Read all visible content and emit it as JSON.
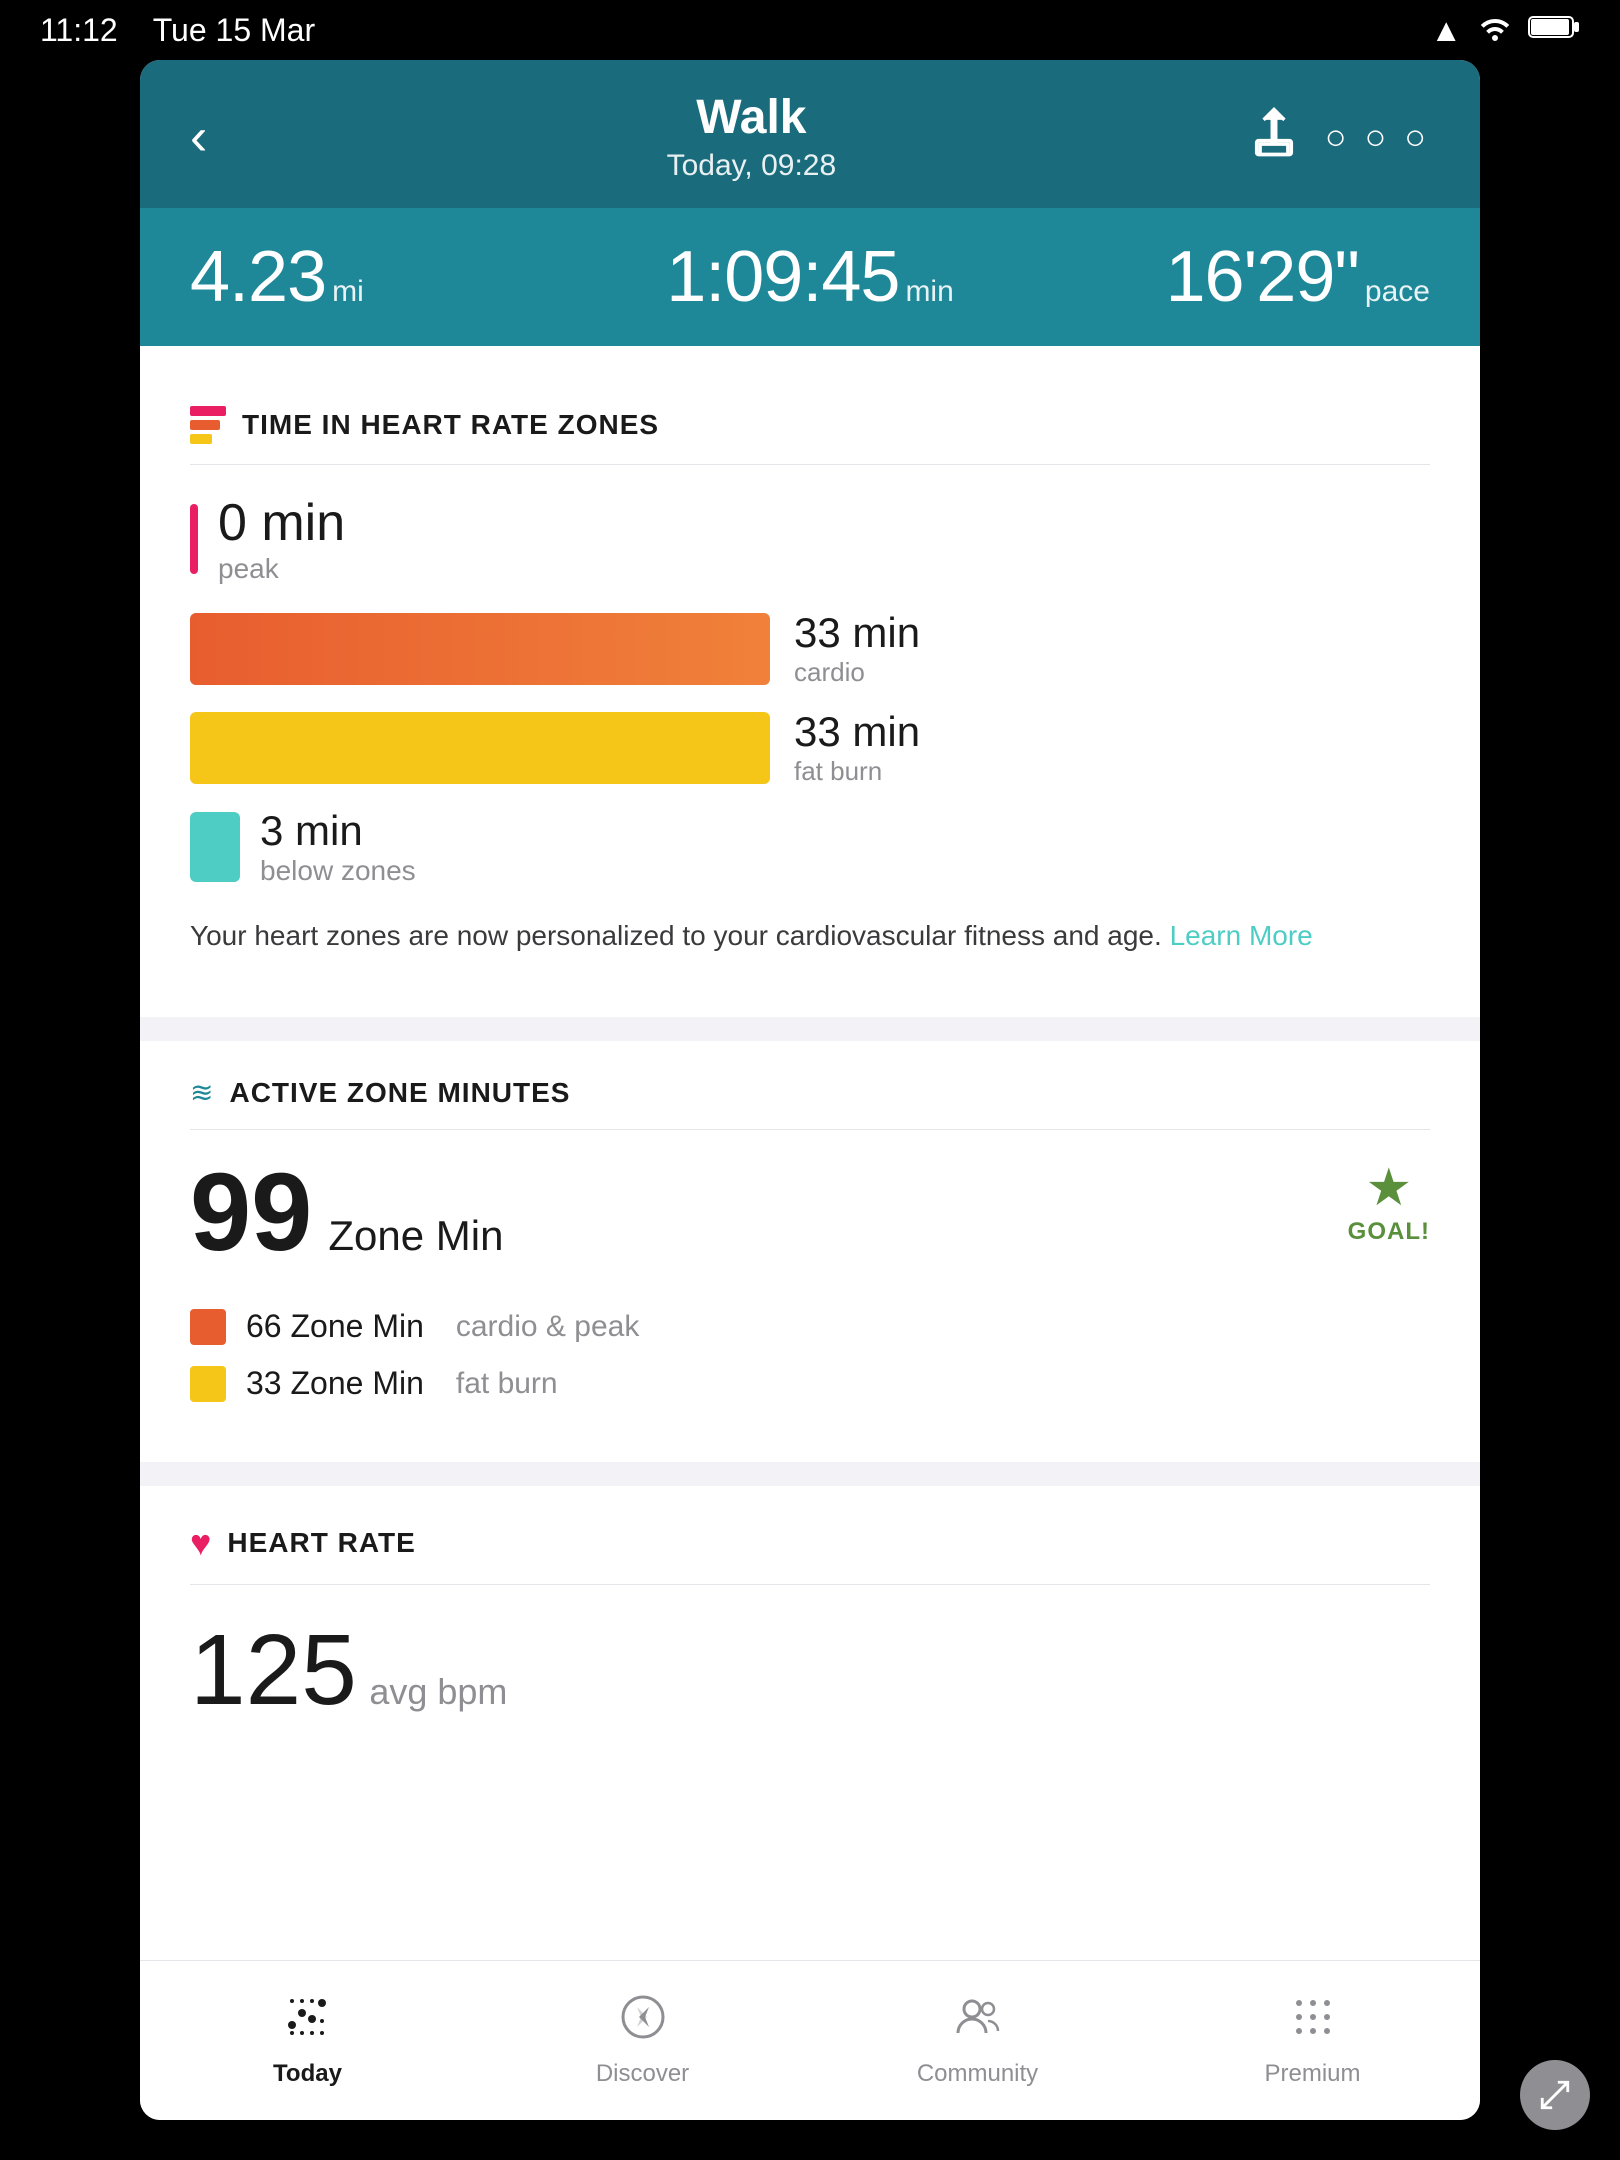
{
  "statusBar": {
    "time": "11:12",
    "date": "Tue 15 Mar",
    "battery": "93%"
  },
  "header": {
    "back": "‹",
    "title": "Walk",
    "subtitle": "Today, 09:28",
    "share": "⬆",
    "dots": "○ ○ ○"
  },
  "stats": {
    "distance": {
      "value": "4.23",
      "unit": "mi"
    },
    "duration": {
      "value": "1:09:45",
      "unit": "min"
    },
    "pace": {
      "value": "16'29\"",
      "unit": "pace"
    }
  },
  "heartRateZones": {
    "sectionTitle": "TIME IN HEART RATE ZONES",
    "peak": {
      "value": "0 min",
      "label": "peak"
    },
    "cardio": {
      "value": "33 min",
      "label": "cardio"
    },
    "fatBurn": {
      "value": "33 min",
      "label": "fat burn"
    },
    "belowZones": {
      "value": "3 min",
      "label": "below zones"
    },
    "infoText": "Your heart zones are now personalized to your cardiovascular fitness and age.",
    "learnMore": "Learn More"
  },
  "activeZoneMinutes": {
    "sectionTitle": "ACTIVE ZONE MINUTES",
    "totalValue": "99",
    "totalUnit": "Zone Min",
    "goalLabel": "GOAL!",
    "cardioPeak": {
      "value": "66 Zone Min",
      "label": "cardio & peak"
    },
    "fatBurn": {
      "value": "33 Zone Min",
      "label": "fat burn"
    }
  },
  "heartRate": {
    "sectionTitle": "HEART RATE",
    "avgValue": "125",
    "avgUnit": "avg bpm"
  },
  "bottomNav": {
    "today": {
      "label": "Today",
      "active": true
    },
    "discover": {
      "label": "Discover",
      "active": false
    },
    "community": {
      "label": "Community",
      "active": false
    },
    "premium": {
      "label": "Premium",
      "active": false
    }
  }
}
